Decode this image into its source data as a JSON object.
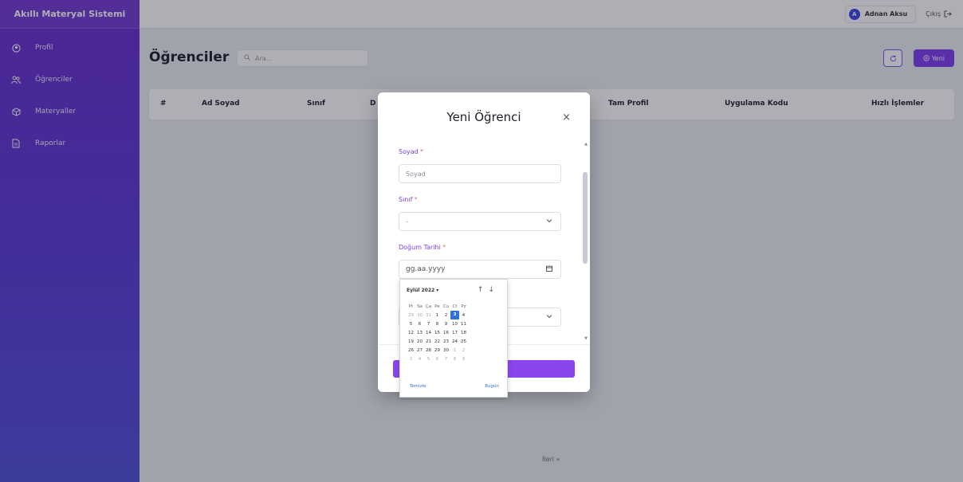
{
  "app": {
    "title": "Akıllı Materyal Sistemi"
  },
  "sidebar": {
    "items": [
      {
        "label": "Profil",
        "icon": "user-circle-icon"
      },
      {
        "label": "Öğrenciler",
        "icon": "users-icon"
      },
      {
        "label": "Materyaller",
        "icon": "cube-icon"
      },
      {
        "label": "Raporlar",
        "icon": "document-icon"
      }
    ]
  },
  "topbar": {
    "user_initial": "A",
    "user_name": "Adnan Aksu",
    "logout_label": "Çıkış"
  },
  "main": {
    "title": "Öğrenciler",
    "search_placeholder": "Ara...",
    "new_label": "Yeni",
    "table_headers": [
      "#",
      "Ad Soyad",
      "Sınıf",
      "D",
      "Tam Profil",
      "Uygulama Kodu",
      "Hızlı İşlemler"
    ],
    "pager_next": "İleri"
  },
  "modal": {
    "title": "Yeni Öğrenci",
    "close": "×",
    "fields": {
      "soyad_label": "Soyad",
      "soyad_placeholder": "Soyad",
      "sinif_label": "Sınıf",
      "sinif_value": "-",
      "dogum_label": "Doğum Tarihi",
      "dogum_placeholder": "gg.aa.yyyy"
    },
    "required_mark": "*"
  },
  "datepicker": {
    "month_label": "Eylül 2022 ▾",
    "weekdays": [
      "Pt",
      "Sa",
      "Ça",
      "Pe",
      "Cu",
      "Ct",
      "Pz"
    ],
    "weeks": [
      [
        "29",
        "30",
        "31",
        "1",
        "2",
        "3",
        "4"
      ],
      [
        "5",
        "6",
        "7",
        "8",
        "9",
        "10",
        "11"
      ],
      [
        "12",
        "13",
        "14",
        "15",
        "16",
        "17",
        "18"
      ],
      [
        "19",
        "20",
        "21",
        "22",
        "23",
        "24",
        "25"
      ],
      [
        "26",
        "27",
        "28",
        "29",
        "30",
        "1",
        "2"
      ],
      [
        "3",
        "4",
        "5",
        "6",
        "7",
        "8",
        "9"
      ]
    ],
    "selected": "3",
    "clear_label": "Temizle",
    "today_label": "Bugün"
  },
  "colors": {
    "accent": "#7d3cf0",
    "sidebar_top": "#6a2fd0",
    "sidebar_bottom": "#4f51d8",
    "selected_day": "#2f6fe0"
  }
}
